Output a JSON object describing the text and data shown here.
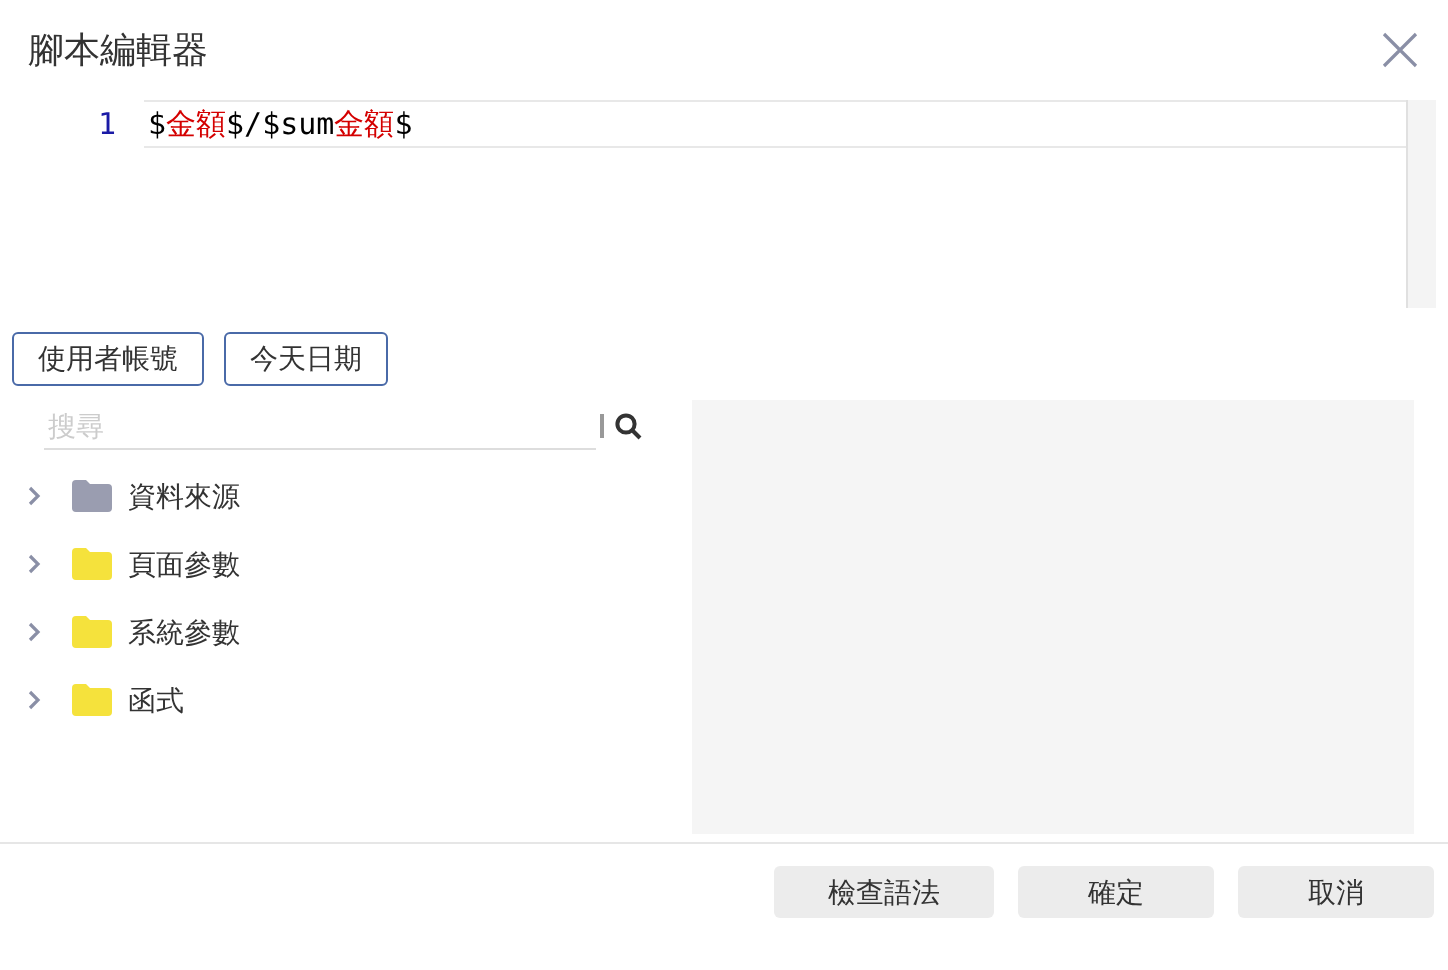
{
  "window": {
    "title": "腳本編輯器"
  },
  "editor": {
    "lines": [
      {
        "number": "1",
        "tokens": [
          {
            "kind": "plain",
            "text": "$"
          },
          {
            "kind": "field",
            "text": "金額"
          },
          {
            "kind": "plain",
            "text": "$/$sum"
          },
          {
            "kind": "field",
            "text": "金額"
          },
          {
            "kind": "plain",
            "text": "$"
          }
        ]
      }
    ]
  },
  "insert_buttons": [
    "使用者帳號",
    "今天日期"
  ],
  "search": {
    "placeholder": "搜尋"
  },
  "tree": [
    {
      "label": "資料來源",
      "expanded": false,
      "color": "#9a9db0"
    },
    {
      "label": "頁面參數",
      "expanded": false,
      "color": "#f5e23c"
    },
    {
      "label": "系統參數",
      "expanded": false,
      "color": "#f5e23c"
    },
    {
      "label": "函式",
      "expanded": false,
      "color": "#f5e23c"
    }
  ],
  "buttons": [
    "檢查語法",
    "確定",
    "取消"
  ]
}
